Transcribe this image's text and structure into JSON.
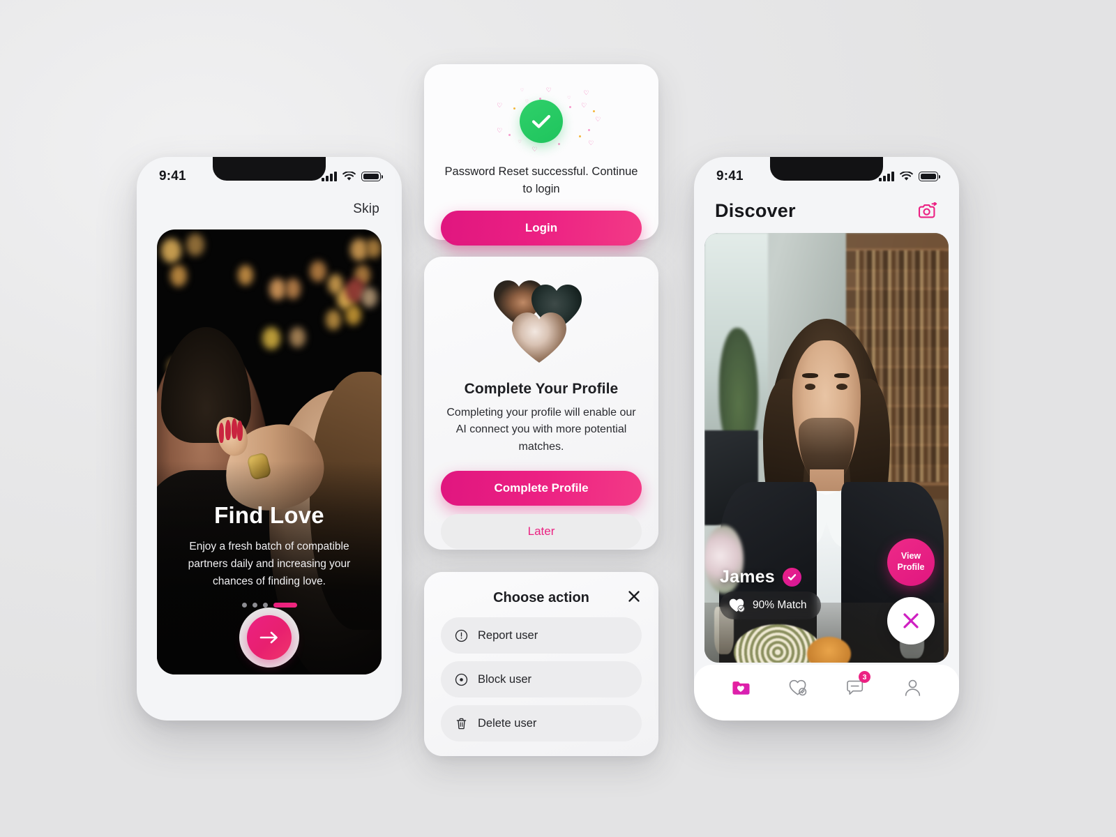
{
  "theme": {
    "accent": "#ec2183",
    "accent_dark": "#e0167f",
    "success_green": "#1fc45d",
    "bg": "#e9e9ea",
    "phone_bg": "#f4f5f7"
  },
  "onboarding_screen": {
    "status_bar": {
      "time": "9:41",
      "signal_icon": "cellular-bars-icon",
      "wifi_icon": "wifi-icon",
      "battery_icon": "battery-icon"
    },
    "skip_label": "Skip",
    "hero": {
      "image_alt": "couple-dancing-photo",
      "title": "Find Love",
      "description": "Enjoy a fresh batch of compatible partners daily and increasing your chances of finding love."
    },
    "pagination": {
      "total": 4,
      "active_index": 3
    },
    "next_button": {
      "icon": "arrow-right-icon",
      "label": "Next"
    }
  },
  "reset_card": {
    "icon": "success-check-icon",
    "message": "Password Reset successful. Continue to login",
    "login_label": "Login"
  },
  "profile_card": {
    "image_alt": "heart-collage-photos",
    "title": "Complete Your Profile",
    "body": "Completing your profile will enable our AI connect you with more potential matches.",
    "primary_label": "Complete Profile",
    "secondary_label": "Later"
  },
  "action_sheet": {
    "title": "Choose action",
    "close_icon": "close-icon",
    "items": [
      {
        "icon": "exclamation-circle-icon",
        "label": "Report user"
      },
      {
        "icon": "block-circle-icon",
        "label": "Block user"
      },
      {
        "icon": "trash-icon",
        "label": "Delete user"
      }
    ]
  },
  "discover_screen": {
    "status_bar": {
      "time": "9:41",
      "signal_icon": "cellular-bars-icon",
      "wifi_icon": "wifi-icon",
      "battery_icon": "battery-icon"
    },
    "title": "Discover",
    "camera_icon": "add-photo-camera-icon",
    "profile": {
      "image_alt": "man-in-library-photo",
      "name": "James",
      "verified_icon": "verified-badge-icon",
      "match_icon": "heart-check-icon",
      "match_text": "90% Match",
      "view_profile_line1": "View",
      "view_profile_line2": "Profile",
      "nope_icon": "close-x-icon"
    },
    "tabbar": [
      {
        "icon": "folder-heart-icon",
        "name": "discover",
        "active": true,
        "badge": ""
      },
      {
        "icon": "heart-check-icon",
        "name": "matches",
        "active": false,
        "badge": ""
      },
      {
        "icon": "chat-bubble-icon",
        "name": "messages",
        "active": false,
        "badge": "3"
      },
      {
        "icon": "user-icon",
        "name": "profile",
        "active": false,
        "badge": ""
      }
    ]
  }
}
